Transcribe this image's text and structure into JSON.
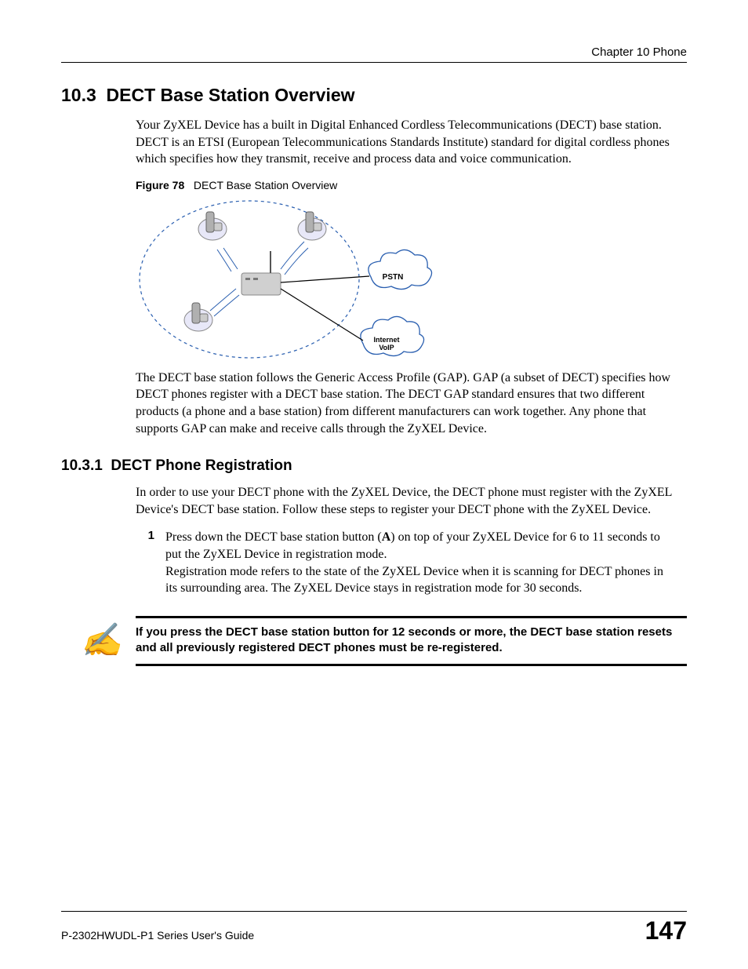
{
  "header": {
    "chapter": "Chapter 10 Phone"
  },
  "section": {
    "number": "10.3",
    "title": "DECT Base Station Overview",
    "intro": "Your ZyXEL Device has a built in Digital Enhanced Cordless Telecommunications (DECT) base station. DECT is an ETSI (European Telecommunications Standards Institute) standard for digital cordless phones which specifies how they transmit, receive and process data and voice communication."
  },
  "figure": {
    "label": "Figure 78",
    "caption": "DECT Base Station Overview",
    "labels": {
      "pstn": "PSTN",
      "internet_voip_1": "Internet",
      "internet_voip_2": "VoIP"
    }
  },
  "para_after_figure": "The DECT base station follows the Generic Access Profile (GAP). GAP (a subset of DECT) specifies how DECT phones register with a DECT base station. The DECT GAP standard ensures that two different products (a phone and a base station) from different manufacturers can work together. Any phone that supports GAP can make and receive calls through the ZyXEL Device.",
  "subsection": {
    "number": "10.3.1",
    "title": "DECT Phone Registration",
    "intro": "In order to use your DECT phone with the ZyXEL Device, the DECT phone must register with the ZyXEL Device's DECT base station. Follow these steps to register your DECT phone with the ZyXEL Device."
  },
  "list": {
    "item1_num": "1",
    "item1_text_a": "Press down the DECT base station button (",
    "item1_text_bold": "A",
    "item1_text_b": ") on top of your ZyXEL Device for 6 to 11 seconds to put the ZyXEL Device in registration mode.",
    "item1_text_c": "Registration mode refers to the state of the ZyXEL Device when it is scanning for DECT phones in its surrounding area. The ZyXEL Device stays in registration mode for 30 seconds."
  },
  "note": {
    "text": "If you press the DECT base station button for 12 seconds or more, the DECT base station resets and all previously registered DECT phones must be re-registered."
  },
  "footer": {
    "guide": "P-2302HWUDL-P1 Series User's Guide",
    "page": "147"
  }
}
